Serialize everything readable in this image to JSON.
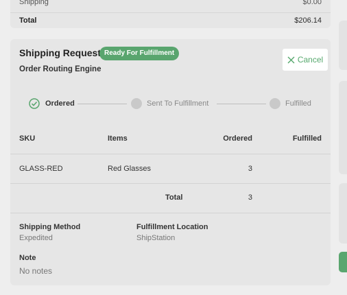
{
  "summary": {
    "shipping_label": "Shipping",
    "shipping_value": "$0.00",
    "total_label": "Total",
    "total_value": "$206.14"
  },
  "request": {
    "title": "Shipping Request",
    "status_badge": "Ready For Fulfillment",
    "subtitle": "Order Routing Engine",
    "cancel_label": "Cancel",
    "colors": {
      "accent": "#59a56e",
      "step_inactive": "#c9c9c9"
    },
    "steps": [
      {
        "label": "Ordered",
        "state": "complete",
        "icon": "check-circle-icon"
      },
      {
        "label": "Sent To Fulfillment",
        "state": "pending"
      },
      {
        "label": "Fulfilled",
        "state": "pending"
      }
    ],
    "table": {
      "headers": [
        "SKU",
        "Items",
        "Ordered",
        "Fulfilled"
      ],
      "rows": [
        {
          "sku": "GLASS-RED",
          "item": "Red Glasses",
          "ordered": "3",
          "fulfilled": ""
        }
      ],
      "total_label": "Total",
      "total_ordered": "3"
    },
    "shipping_method_label": "Shipping Method",
    "shipping_method_value": "Expedited",
    "fulfillment_location_label": "Fulfillment Location",
    "fulfillment_location_value": "ShipStation",
    "note_label": "Note",
    "note_value": "No notes"
  }
}
